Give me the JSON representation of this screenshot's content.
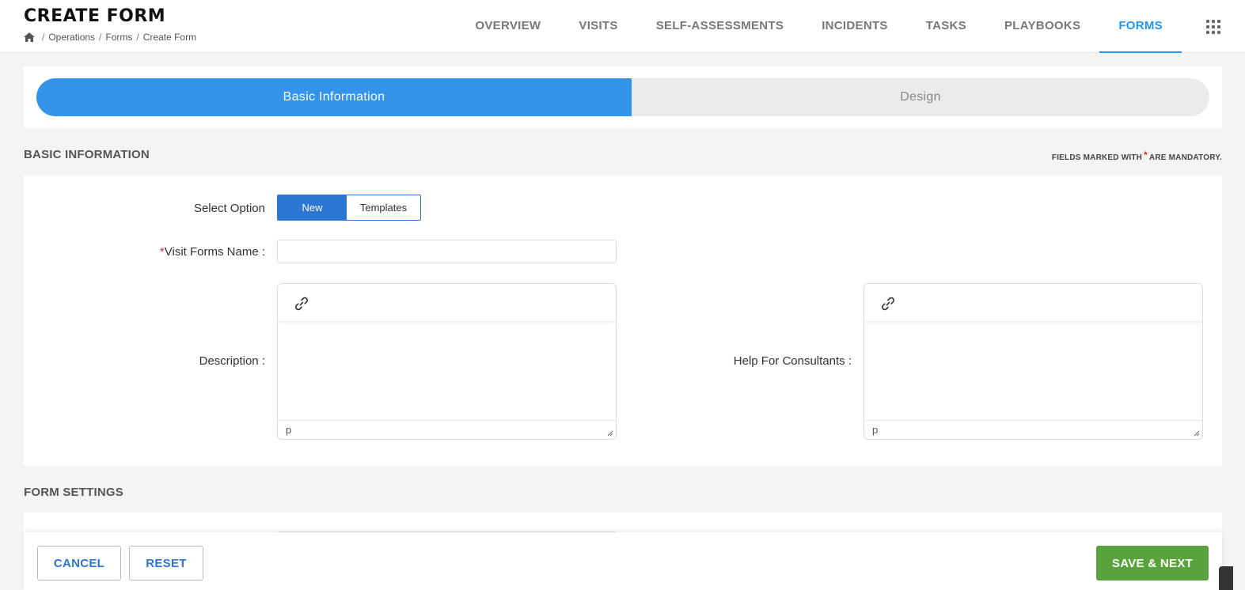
{
  "header": {
    "title": "CREATE FORM",
    "breadcrumb": [
      "Operations",
      "Forms",
      "Create Form"
    ],
    "nav": [
      {
        "label": "OVERVIEW",
        "active": false
      },
      {
        "label": "VISITS",
        "active": false
      },
      {
        "label": "SELF-ASSESSMENTS",
        "active": false
      },
      {
        "label": "INCIDENTS",
        "active": false
      },
      {
        "label": "TASKS",
        "active": false
      },
      {
        "label": "PLAYBOOKS",
        "active": false
      },
      {
        "label": "FORMS",
        "active": true
      }
    ]
  },
  "stepper": {
    "steps": [
      {
        "label": "Basic Information",
        "active": true
      },
      {
        "label": "Design",
        "active": false
      }
    ]
  },
  "basic_info": {
    "section_title": "BASIC INFORMATION",
    "mandatory_prefix": "FIELDS MARKED WITH",
    "mandatory_star": "*",
    "mandatory_suffix": "ARE MANDATORY.",
    "select_option_label": "Select Option",
    "options": [
      "New",
      "Templates"
    ],
    "selected_option": "New",
    "required_marker": "*",
    "name_label": "Visit Forms Name :",
    "name_value": "",
    "description_label": "Description :",
    "description_status": "p",
    "help_label": "Help For Consultants :",
    "help_status": "p"
  },
  "form_settings": {
    "section_title": "FORM SETTINGS"
  },
  "footer": {
    "cancel_label": "CANCEL",
    "reset_label": "RESET",
    "save_next_label": "SAVE & NEXT"
  },
  "colors": {
    "accent": "#2196f3",
    "step_active": "#3494ea",
    "toggle": "#2a76d2",
    "save": "#5aa33c",
    "required": "#d32f2f"
  }
}
